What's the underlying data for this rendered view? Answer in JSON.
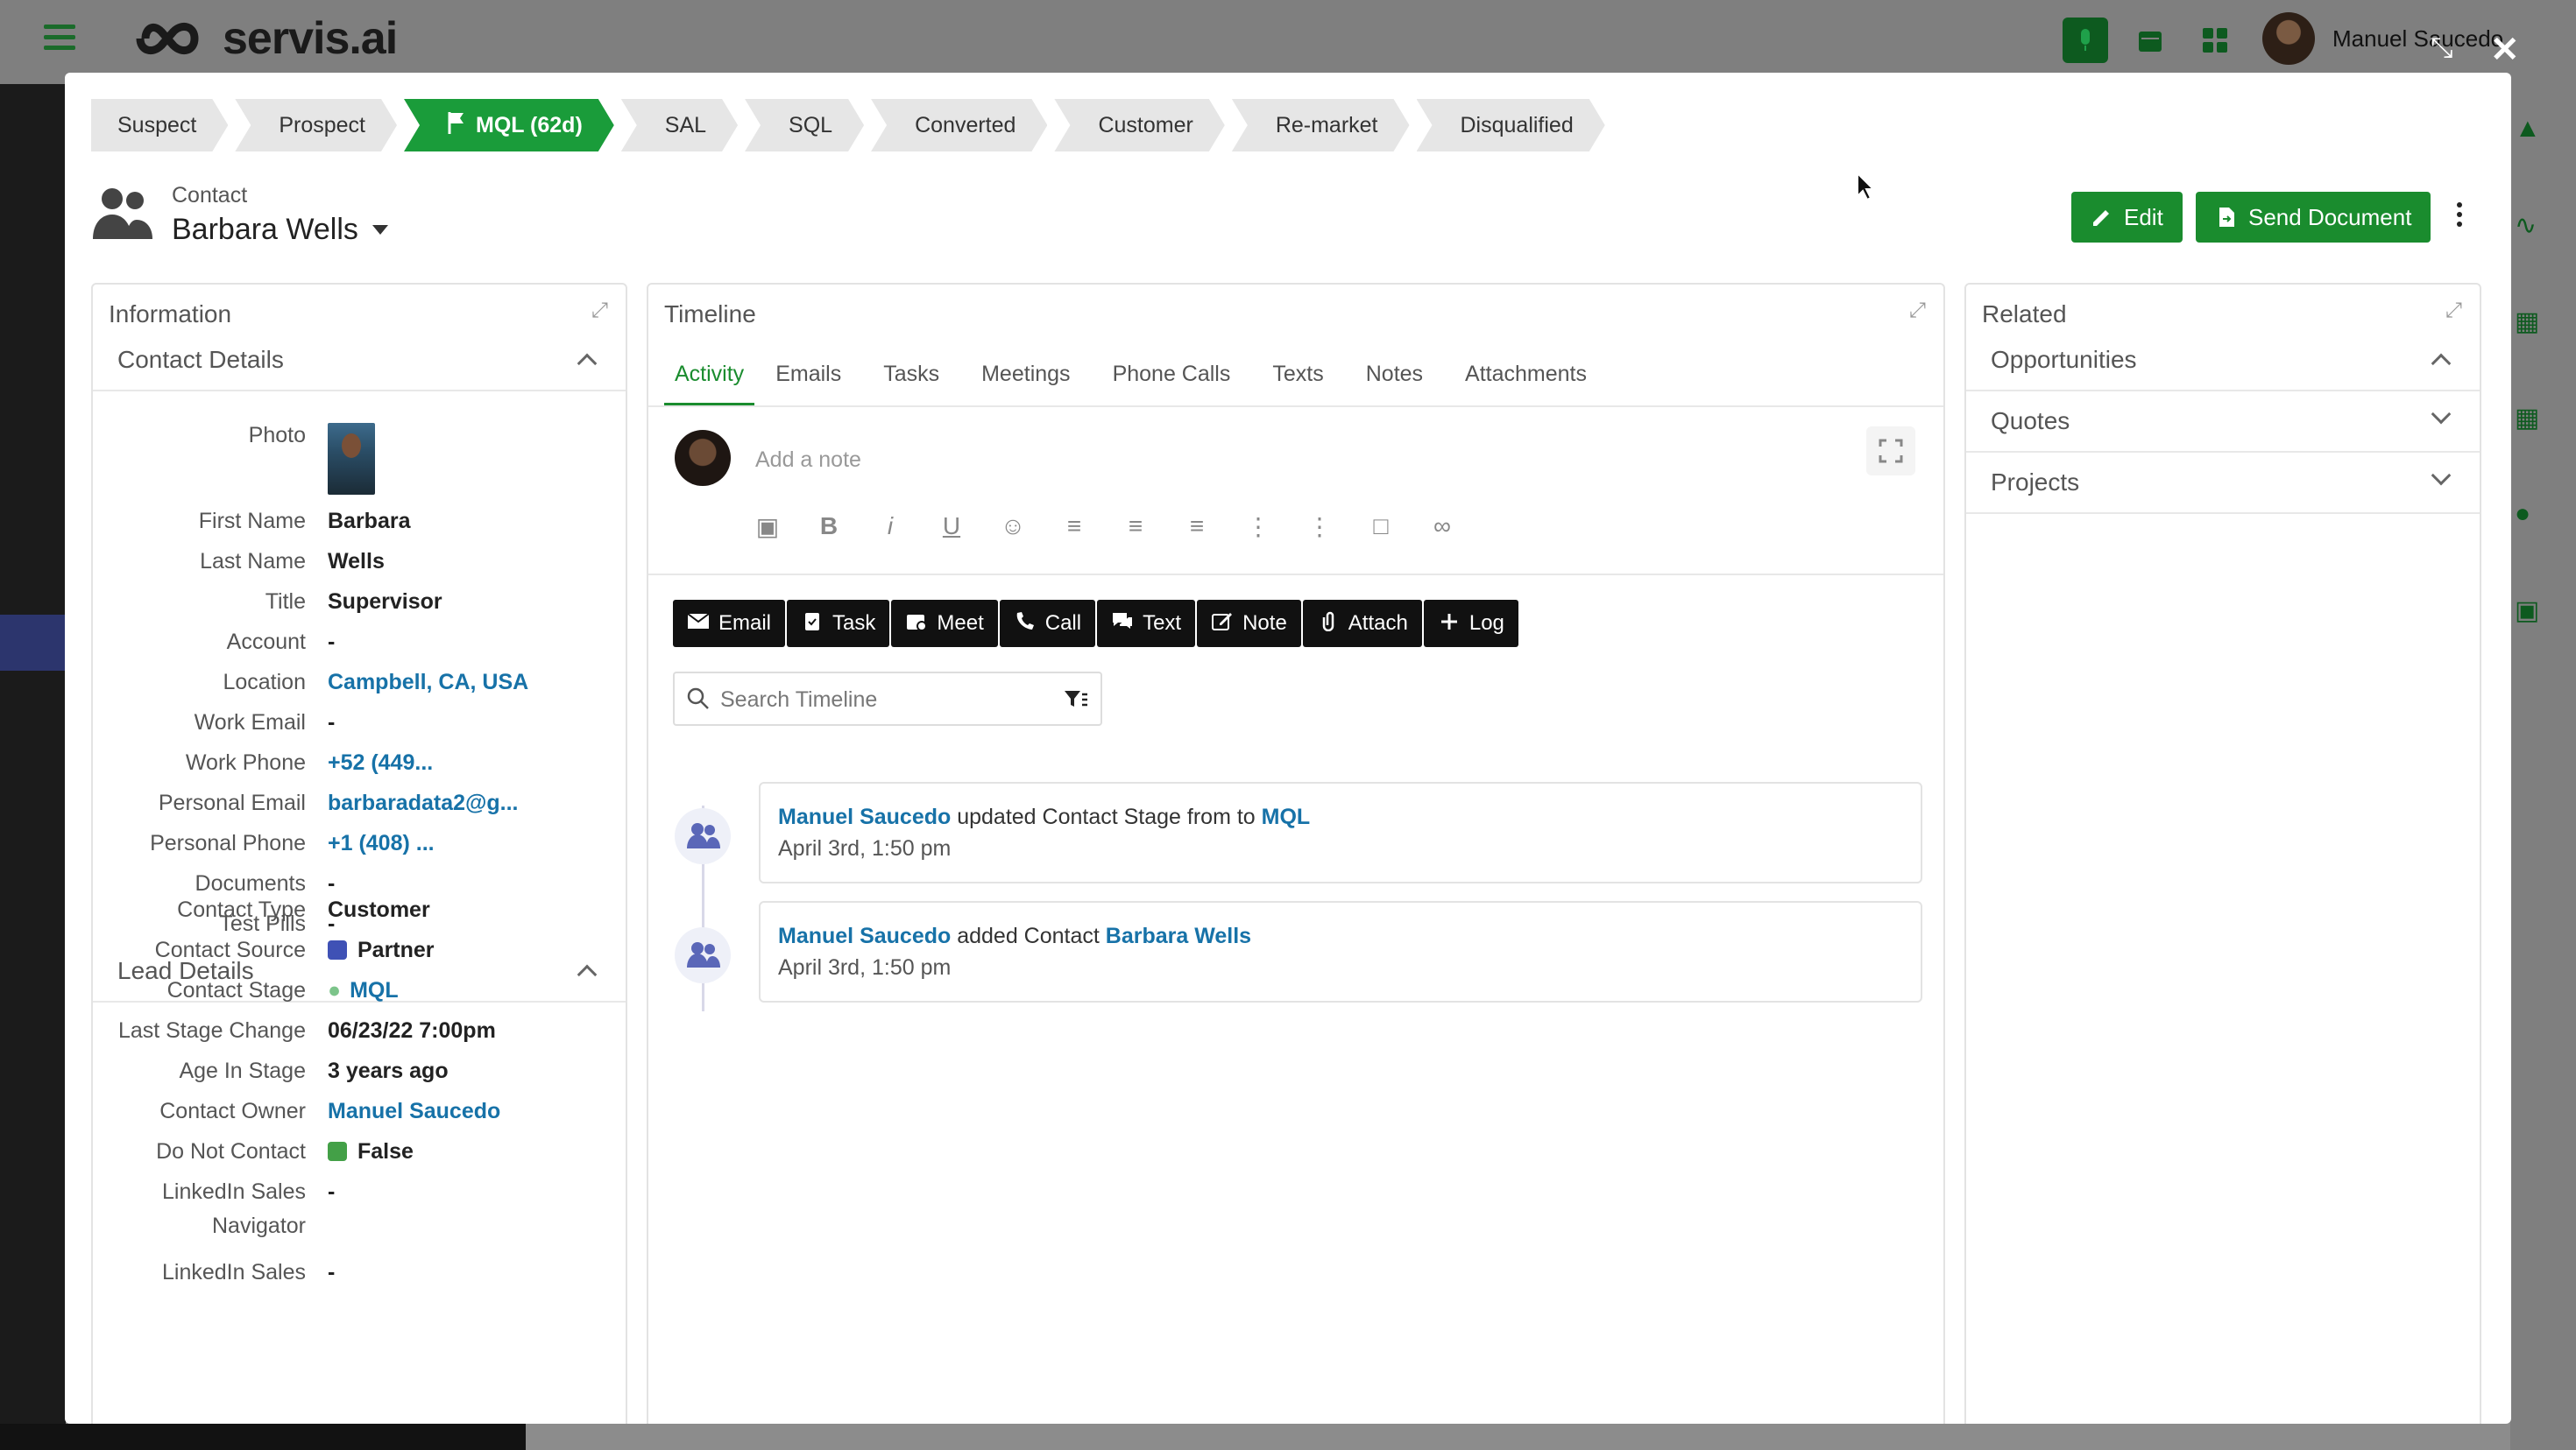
{
  "app": {
    "logo_text": "servis.ai",
    "user_name": "Manuel Saucedo"
  },
  "stages": [
    {
      "label": "Suspect",
      "current": false
    },
    {
      "label": "Prospect",
      "current": false
    },
    {
      "label": "MQL (62d)",
      "current": true
    },
    {
      "label": "SAL",
      "current": false
    },
    {
      "label": "SQL",
      "current": false
    },
    {
      "label": "Converted",
      "current": false
    },
    {
      "label": "Customer",
      "current": false
    },
    {
      "label": "Re-market",
      "current": false
    },
    {
      "label": "Disqualified",
      "current": false
    }
  ],
  "header": {
    "record_type": "Contact",
    "record_name": "Barbara Wells",
    "edit_label": "Edit",
    "send_document_label": "Send Document"
  },
  "information": {
    "title": "Information",
    "contact_details": {
      "title": "Contact Details",
      "photo_label": "Photo",
      "fields": [
        {
          "label": "First Name",
          "value": "Barbara",
          "link": false
        },
        {
          "label": "Last Name",
          "value": "Wells",
          "link": false
        },
        {
          "label": "Title",
          "value": "Supervisor",
          "link": false
        },
        {
          "label": "Account",
          "value": "-",
          "link": false
        },
        {
          "label": "Location",
          "value": "Campbell, CA, USA",
          "link": true
        },
        {
          "label": "Work Email",
          "value": "-",
          "link": false
        },
        {
          "label": "Work Phone",
          "value": "+52 (449...",
          "link": true
        },
        {
          "label": "Personal Email",
          "value": "barbaradata2@g...",
          "link": true
        },
        {
          "label": "Personal Phone",
          "value": "+1 (408) ...",
          "link": true
        },
        {
          "label": "Documents",
          "value": "-",
          "link": false
        },
        {
          "label": "Test Pills",
          "value": "-",
          "link": false
        }
      ]
    },
    "lead_details": {
      "title": "Lead Details",
      "fields": [
        {
          "label": "Contact Type",
          "value": "Customer"
        },
        {
          "label": "Contact Source",
          "value": "Partner",
          "dot_color": "#3f51b5"
        },
        {
          "label": "Contact Stage",
          "value": "MQL"
        },
        {
          "label": "Last Stage Change",
          "value": "06/23/22 7:00pm"
        },
        {
          "label": "Age In Stage",
          "value": "3 years ago"
        },
        {
          "label": "Contact Owner",
          "value": "Manuel Saucedo"
        },
        {
          "label": "Do Not Contact",
          "value": "False",
          "dot_color": "#43a047"
        },
        {
          "label": "LinkedIn Sales",
          "label2": "Navigator",
          "value": "-"
        },
        {
          "label": "LinkedIn Sales",
          "value": "-"
        }
      ]
    }
  },
  "timeline": {
    "title": "Timeline",
    "tabs": [
      "Activity",
      "Emails",
      "Tasks",
      "Meetings",
      "Phone Calls",
      "Texts",
      "Notes",
      "Attachments"
    ],
    "note_placeholder": "Add a note",
    "actions": [
      "Email",
      "Task",
      "Meet",
      "Call",
      "Text",
      "Note",
      "Attach",
      "Log"
    ],
    "search_placeholder": "Search Timeline",
    "entries": [
      {
        "actor": "Manuel Saucedo",
        "text": " updated Contact Stage from to ",
        "target": "MQL",
        "time": "April 3rd, 1:50 pm"
      },
      {
        "actor": "Manuel Saucedo",
        "text": " added Contact ",
        "target": "Barbara Wells",
        "time": "April 3rd, 1:50 pm"
      }
    ]
  },
  "related": {
    "title": "Related",
    "sections": [
      "Opportunities",
      "Quotes",
      "Projects"
    ]
  },
  "colors": {
    "brand_green": "#1a8c2e",
    "link_blue": "#1772a8"
  }
}
